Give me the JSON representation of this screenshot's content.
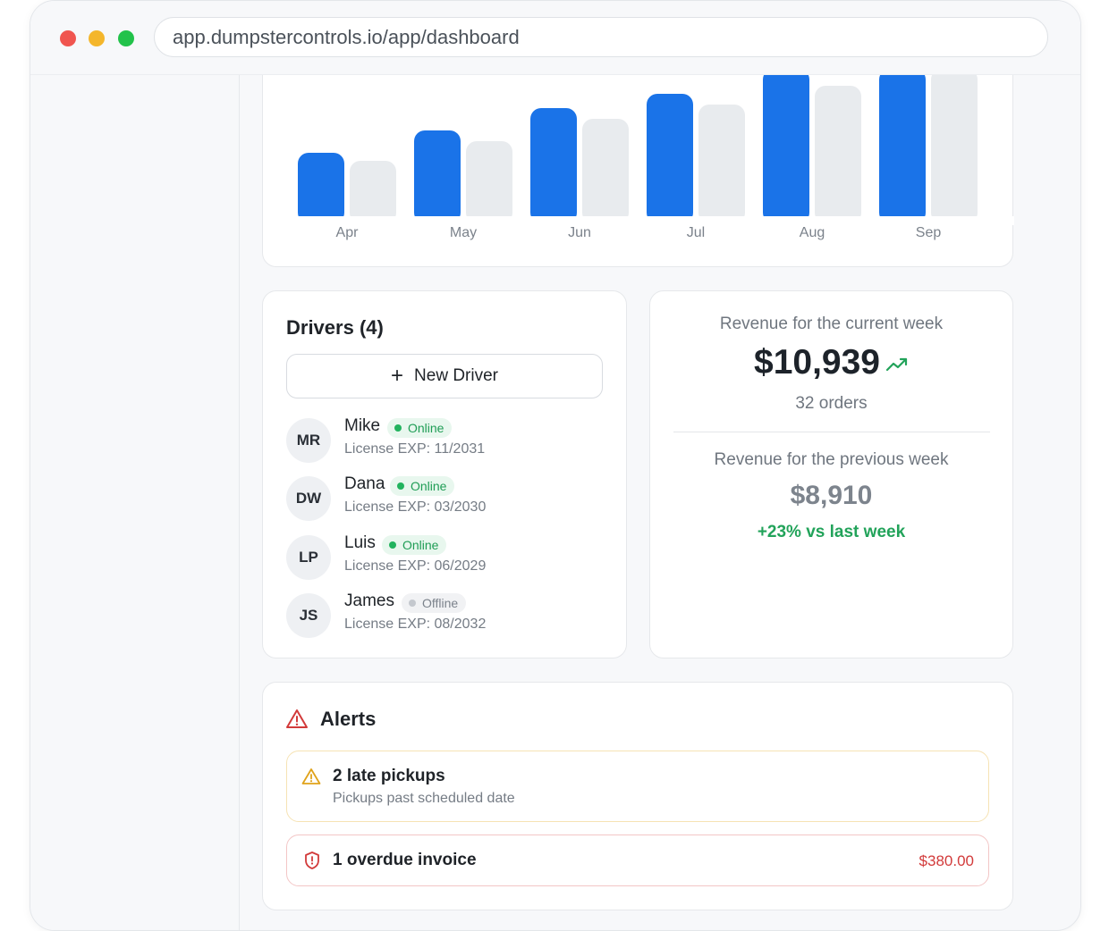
{
  "browser": {
    "url": "app.dumpstercontrols.io/app/dashboard"
  },
  "colors": {
    "current": "#1a73e8",
    "previous": "#e8ebee",
    "accent_green": "#22a35a",
    "alert_red": "#d23a3a",
    "alert_amber": "#e0a21a"
  },
  "chart_data": {
    "type": "bar",
    "categories": [
      "Apr",
      "May",
      "Jun",
      "Jul",
      "Aug",
      "Sep"
    ],
    "series": [
      {
        "values": [
          71,
          96,
          121,
          137,
          165,
          165
        ]
      },
      {
        "values": [
          62,
          84,
          109,
          125,
          146,
          165
        ]
      }
    ],
    "grid": false
  },
  "drivers": {
    "title": "Drivers (4)",
    "new_button": "New Driver",
    "list": [
      {
        "initials": "MR",
        "name": "Mike",
        "status": "Online",
        "license": "License EXP: 11/2031"
      },
      {
        "initials": "DW",
        "name": "Dana",
        "status": "Online",
        "license": "License EXP: 03/2030"
      },
      {
        "initials": "LP",
        "name": "Luis",
        "status": "Online",
        "license": "License EXP: 06/2029"
      },
      {
        "initials": "JS",
        "name": "James",
        "status": "Offline",
        "license": "License EXP: 08/2032"
      }
    ]
  },
  "revenue": {
    "current_label": "Revenue for the current week",
    "current_value": "$10,939",
    "orders": "32 orders",
    "previous_label": "Revenue for the previous week",
    "previous_value": "$8,910",
    "change": "+23% vs last week"
  },
  "alerts": {
    "title": "Alerts",
    "items": [
      {
        "title": "2 late pickups",
        "subtitle": "Pickups past scheduled date",
        "icon": "warning-triangle-icon"
      },
      {
        "title": "1 overdue invoice",
        "amount": "$380.00",
        "icon": "shield-alert-icon"
      }
    ]
  }
}
